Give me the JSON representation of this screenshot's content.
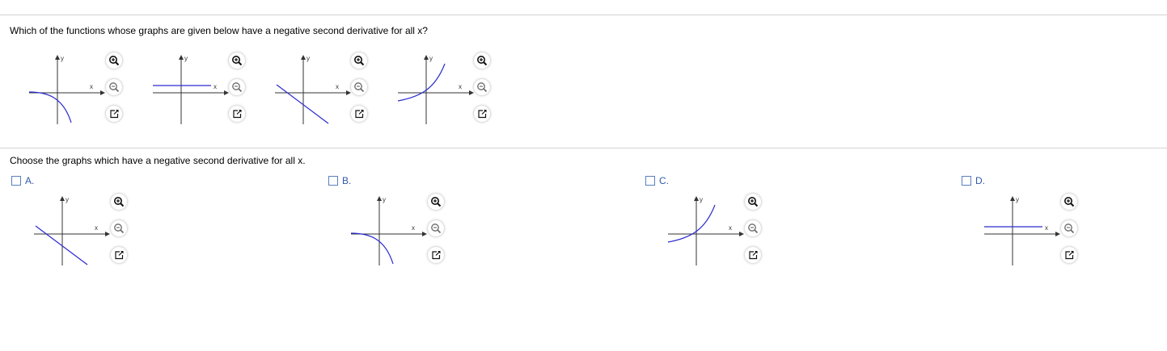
{
  "question": {
    "text": "Which of the functions whose graphs are given below have a negative second derivative for all x?"
  },
  "instruction": {
    "text": "Choose the graphs which have a negative second derivative for all x."
  },
  "graph_axis_labels": {
    "x": "x",
    "y": "y"
  },
  "graph_tools": [
    "zoom-in-icon",
    "zoom-out-icon",
    "open-in-new-window-icon"
  ],
  "colors": {
    "curve": "#2a2ad0",
    "axis": "#333333",
    "choice_label": "#3158a8",
    "checkbox_border": "#5a7fbf",
    "divider": "#d2d2d2"
  },
  "question_graphs": [
    {
      "curve": "decreasing-concave-down"
    },
    {
      "curve": "horizontal-line"
    },
    {
      "curve": "decreasing-line"
    },
    {
      "curve": "increasing-concave-up"
    }
  ],
  "choices": [
    {
      "letter": "A.",
      "checked": false,
      "curve": "decreasing-line"
    },
    {
      "letter": "B.",
      "checked": false,
      "curve": "decreasing-concave-down"
    },
    {
      "letter": "C.",
      "checked": false,
      "curve": "increasing-concave-up"
    },
    {
      "letter": "D.",
      "checked": false,
      "curve": "horizontal-line"
    }
  ]
}
